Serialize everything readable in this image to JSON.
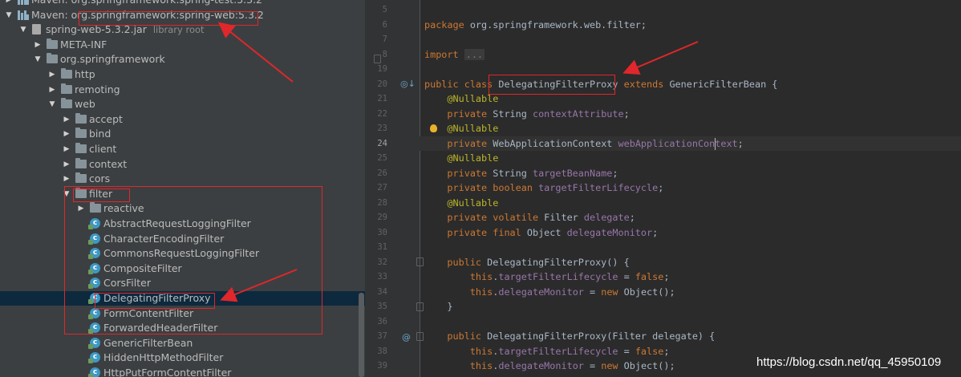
{
  "project_tree": {
    "rows": [
      {
        "indent": 0,
        "arrow": "▶",
        "icon": "library",
        "label": "Maven: org.springframework:spring-test:5.3.2",
        "hint": ""
      },
      {
        "indent": 0,
        "arrow": "▼",
        "icon": "library",
        "label": "Maven: org.springframework:spring-web:5.3.2",
        "hint": ""
      },
      {
        "indent": 1,
        "arrow": "▼",
        "icon": "jar",
        "label": "spring-web-5.3.2.jar",
        "hint": "library root"
      },
      {
        "indent": 2,
        "arrow": "▶",
        "icon": "folder",
        "label": "META-INF",
        "hint": ""
      },
      {
        "indent": 2,
        "arrow": "▼",
        "icon": "folder",
        "label": "org.springframework",
        "hint": ""
      },
      {
        "indent": 3,
        "arrow": "▶",
        "icon": "folder",
        "label": "http",
        "hint": ""
      },
      {
        "indent": 3,
        "arrow": "▶",
        "icon": "folder",
        "label": "remoting",
        "hint": ""
      },
      {
        "indent": 3,
        "arrow": "▼",
        "icon": "folder",
        "label": "web",
        "hint": ""
      },
      {
        "indent": 4,
        "arrow": "▶",
        "icon": "folder",
        "label": "accept",
        "hint": ""
      },
      {
        "indent": 4,
        "arrow": "▶",
        "icon": "folder",
        "label": "bind",
        "hint": ""
      },
      {
        "indent": 4,
        "arrow": "▶",
        "icon": "folder",
        "label": "client",
        "hint": ""
      },
      {
        "indent": 4,
        "arrow": "▶",
        "icon": "folder",
        "label": "context",
        "hint": ""
      },
      {
        "indent": 4,
        "arrow": "▶",
        "icon": "folder",
        "label": "cors",
        "hint": ""
      },
      {
        "indent": 4,
        "arrow": "▼",
        "icon": "folder",
        "label": "filter",
        "hint": ""
      },
      {
        "indent": 5,
        "arrow": "▶",
        "icon": "folder",
        "label": "reactive",
        "hint": ""
      },
      {
        "indent": 5,
        "arrow": "",
        "icon": "class",
        "label": "AbstractRequestLoggingFilter",
        "hint": ""
      },
      {
        "indent": 5,
        "arrow": "",
        "icon": "class",
        "label": "CharacterEncodingFilter",
        "hint": ""
      },
      {
        "indent": 5,
        "arrow": "",
        "icon": "class",
        "label": "CommonsRequestLoggingFilter",
        "hint": ""
      },
      {
        "indent": 5,
        "arrow": "",
        "icon": "class",
        "label": "CompositeFilter",
        "hint": ""
      },
      {
        "indent": 5,
        "arrow": "",
        "icon": "class",
        "label": "CorsFilter",
        "hint": ""
      },
      {
        "indent": 5,
        "arrow": "",
        "icon": "class",
        "label": "DelegatingFilterProxy",
        "hint": "",
        "selected": true
      },
      {
        "indent": 5,
        "arrow": "",
        "icon": "class",
        "label": "FormContentFilter",
        "hint": ""
      },
      {
        "indent": 5,
        "arrow": "",
        "icon": "class",
        "label": "ForwardedHeaderFilter",
        "hint": ""
      },
      {
        "indent": 5,
        "arrow": "",
        "icon": "class",
        "label": "GenericFilterBean",
        "hint": ""
      },
      {
        "indent": 5,
        "arrow": "",
        "icon": "class",
        "label": "HiddenHttpMethodFilter",
        "hint": ""
      },
      {
        "indent": 5,
        "arrow": "",
        "icon": "class",
        "label": "HttpPutFormContentFilter",
        "hint": ""
      }
    ]
  },
  "editor": {
    "current_line": "24",
    "lines": [
      {
        "n": "5",
        "code": []
      },
      {
        "n": "6",
        "code": [
          [
            "kw",
            "package "
          ],
          [
            "",
            "org.springframework.web.filter;"
          ]
        ]
      },
      {
        "n": "7",
        "code": []
      },
      {
        "n": "8",
        "code": [
          [
            "kw",
            "import "
          ],
          [
            "fold",
            "..."
          ]
        ]
      },
      {
        "n": "19",
        "code": []
      },
      {
        "n": "20",
        "code": [
          [
            "kw",
            "public class "
          ],
          [
            "",
            "DelegatingFilterProxy "
          ],
          [
            "kw",
            "extends "
          ],
          [
            "",
            "GenericFilterBean {"
          ]
        ]
      },
      {
        "n": "21",
        "code": [
          [
            "",
            "    "
          ],
          [
            "ann",
            "@Nullable"
          ]
        ]
      },
      {
        "n": "22",
        "code": [
          [
            "",
            "    "
          ],
          [
            "kw",
            "private "
          ],
          [
            "",
            "String "
          ],
          [
            "fld",
            "contextAttribute"
          ],
          [
            "",
            ";"
          ]
        ]
      },
      {
        "n": "23",
        "code": [
          [
            "",
            "    "
          ],
          [
            "ann",
            "@Nullable"
          ]
        ]
      },
      {
        "n": "24",
        "code": [
          [
            "",
            "    "
          ],
          [
            "kw",
            "private "
          ],
          [
            "",
            "WebApplicationContext "
          ],
          [
            "fld",
            "webApplicationContext"
          ],
          [
            "",
            ";"
          ]
        ]
      },
      {
        "n": "25",
        "code": [
          [
            "",
            "    "
          ],
          [
            "ann",
            "@Nullable"
          ]
        ]
      },
      {
        "n": "26",
        "code": [
          [
            "",
            "    "
          ],
          [
            "kw",
            "private "
          ],
          [
            "",
            "String "
          ],
          [
            "fld",
            "targetBeanName"
          ],
          [
            "",
            ";"
          ]
        ]
      },
      {
        "n": "27",
        "code": [
          [
            "",
            "    "
          ],
          [
            "kw",
            "private boolean "
          ],
          [
            "fld",
            "targetFilterLifecycle"
          ],
          [
            "",
            ";"
          ]
        ]
      },
      {
        "n": "28",
        "code": [
          [
            "",
            "    "
          ],
          [
            "ann",
            "@Nullable"
          ]
        ]
      },
      {
        "n": "29",
        "code": [
          [
            "",
            "    "
          ],
          [
            "kw",
            "private volatile "
          ],
          [
            "",
            "Filter "
          ],
          [
            "fld",
            "delegate"
          ],
          [
            "",
            ";"
          ]
        ]
      },
      {
        "n": "30",
        "code": [
          [
            "",
            "    "
          ],
          [
            "kw",
            "private final "
          ],
          [
            "",
            "Object "
          ],
          [
            "fld",
            "delegateMonitor"
          ],
          [
            "",
            ";"
          ]
        ]
      },
      {
        "n": "31",
        "code": []
      },
      {
        "n": "32",
        "code": [
          [
            "",
            "    "
          ],
          [
            "kw",
            "public "
          ],
          [
            "",
            "DelegatingFilterProxy() {"
          ]
        ]
      },
      {
        "n": "33",
        "code": [
          [
            "",
            "        "
          ],
          [
            "kw",
            "this"
          ],
          [
            "",
            "."
          ],
          [
            "fld",
            "targetFilterLifecycle"
          ],
          [
            "",
            " = "
          ],
          [
            "kw",
            "false"
          ],
          [
            "",
            ";"
          ]
        ]
      },
      {
        "n": "34",
        "code": [
          [
            "",
            "        "
          ],
          [
            "kw",
            "this"
          ],
          [
            "",
            "."
          ],
          [
            "fld",
            "delegateMonitor"
          ],
          [
            "",
            " = "
          ],
          [
            "kw",
            "new "
          ],
          [
            "",
            "Object();"
          ]
        ]
      },
      {
        "n": "35",
        "code": [
          [
            "",
            "    }"
          ]
        ]
      },
      {
        "n": "36",
        "code": []
      },
      {
        "n": "37",
        "code": [
          [
            "",
            "    "
          ],
          [
            "kw",
            "public "
          ],
          [
            "",
            "DelegatingFilterProxy(Filter delegate) {"
          ]
        ]
      },
      {
        "n": "38",
        "code": [
          [
            "",
            "        "
          ],
          [
            "kw",
            "this"
          ],
          [
            "",
            "."
          ],
          [
            "fld",
            "targetFilterLifecycle"
          ],
          [
            "",
            " = "
          ],
          [
            "kw",
            "false"
          ],
          [
            "",
            ";"
          ]
        ]
      },
      {
        "n": "39",
        "code": [
          [
            "",
            "        "
          ],
          [
            "kw",
            "this"
          ],
          [
            "",
            "."
          ],
          [
            "fld",
            "delegateMonitor"
          ],
          [
            "",
            " = "
          ],
          [
            "kw",
            "new "
          ],
          [
            "",
            "Object();"
          ]
        ]
      }
    ]
  },
  "watermark": "https://blog.csdn.net/qq_45950109",
  "colors": {
    "highlight_box": "#e0272b",
    "selection": "#0d293e",
    "keyword": "#cc7832",
    "annotation": "#bbb529",
    "field": "#9876aa"
  }
}
